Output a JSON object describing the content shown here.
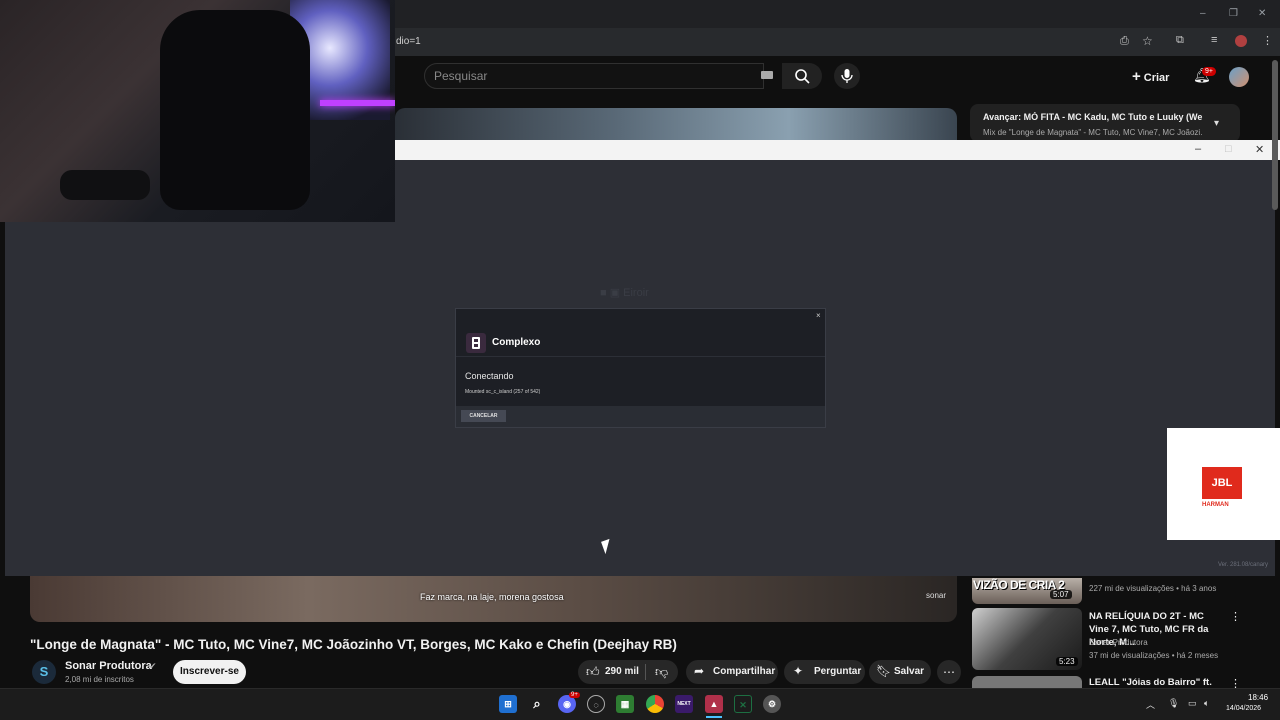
{
  "browser": {
    "url_fragment": "dio=1",
    "window_controls": [
      "–",
      "❐",
      "✕"
    ]
  },
  "youtube": {
    "search_placeholder": "Pesquisar",
    "create_label": "Criar",
    "notification_count": "9+",
    "up_next": {
      "title": "Avançar: MÓ FITA - MC Kadu, MC Tuto e Luuky (We...",
      "subtitle": "Mix de \"Longe de Magnata\" - MC Tuto, MC Vine7, MC Joãozi..."
    },
    "video": {
      "subtitle_caption": "Faz marca, na laje, morena gostosa",
      "watermark": "sonar",
      "title": "\"Longe de Magnata\" - MC Tuto, MC Vine7, MC Joãozinho VT, Borges, MC Kako e Chefin (Deejhay RB)",
      "channel": "Sonar Produtora",
      "subscribers": "2,08 mi de inscritos",
      "subscribe_label": "Inscrever-se",
      "likes": "290 mil",
      "share_label": "Compartilhar",
      "ask_label": "Perguntar",
      "save_label": "Salvar"
    },
    "recommendations": [
      {
        "thumb_text": "VIZÃO DE CRIA 2",
        "duration": "5:07",
        "meta": "227 mi de visualizações • há 3 anos"
      },
      {
        "title": "NA RELÍQUIA DO 2T - MC Vine 7, MC Tuto, MC FR da Norte, M...",
        "channel": "Sonar Produtora",
        "meta": "37 mi de visualizações • há 2 meses",
        "duration": "5:23"
      },
      {
        "title": "LEALL \"Jóias do Bairro\" ft."
      }
    ]
  },
  "client": {
    "version": "Ver. 281.08/canary",
    "ghost_text": "■  ▣ Eiroir",
    "modal": {
      "app_name": "Complexo",
      "status": "Conectando",
      "detail": "Mounted sc_c_island (257 of 542)",
      "cancel_label": "CANCELAR",
      "close": "×"
    }
  },
  "ad": {
    "brand": "JBL",
    "parent": "HARMAN"
  },
  "taskbar": {
    "time": "18:46",
    "date": "14/04/2026",
    "apps": [
      "windows-start",
      "search",
      "discord",
      "steam",
      "nvidia",
      "chrome",
      "next",
      "vpn-client",
      "excel",
      "settings"
    ],
    "discord_badge": "9+"
  },
  "colors": {
    "youtube_bg": "#0f0f0f",
    "client_bg": "#2d2f36",
    "jbl_red": "#e02a1c",
    "notif_red": "#cc0000"
  }
}
